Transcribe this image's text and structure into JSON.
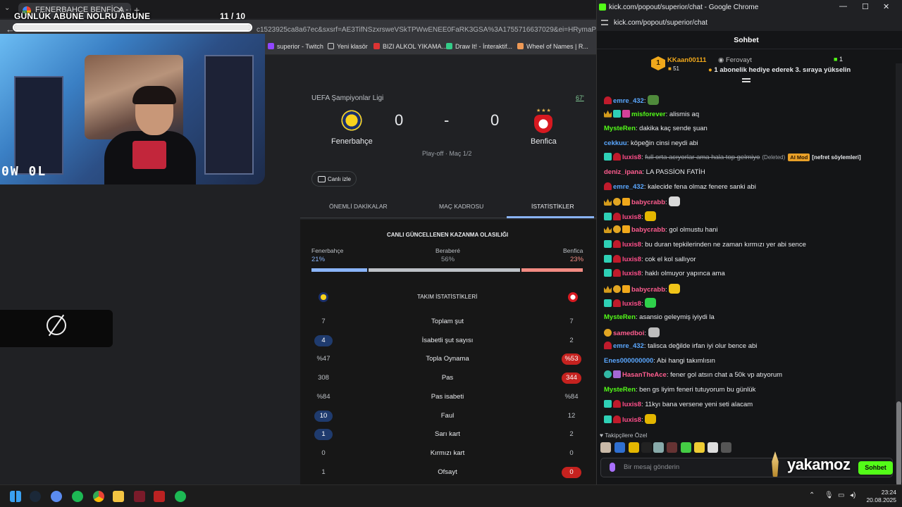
{
  "left_browser": {
    "tab_title": "FENERBAHÇE BENFİCA - Goog",
    "url_fragment": "c1523925ca8a67ec&sxsrf=AE3TifNSzxrsweVSkTPWwENEE0FaRK3GSA%3A1755716637029&ei=HRymaPi8AYrIwPAPiv",
    "bookmarks": [
      "superior - Twitch",
      "Yeni klasör",
      "BIZI ALKOL YIKAMA...",
      "Draw It! - İnteraktif...",
      "Wheel of Names | R..."
    ]
  },
  "overlay": {
    "title": "GÜNLÜK ABUNE NOLRU ABUNE",
    "count": "11  / 10",
    "progress": 1.0,
    "webcam_logo": "0W 0L"
  },
  "match": {
    "competition": "UEFA Şampiyonlar Ligi",
    "minute": "67'",
    "home_team": "Fenerbahçe",
    "away_team": "Benfica",
    "home_score": "0",
    "away_score": "0",
    "separator": "-",
    "round": "Play-off · Maç 1/2",
    "watch_label": "Canlı izle",
    "tabs": [
      "ÖNEMLİ DAKİKALAR",
      "MAÇ KADROSU",
      "İSTATİSTİKLER"
    ],
    "active_tab": "İSTATİSTİKLER",
    "prob_title": "CANLI GÜNCELLENEN KAZANMA OLASILIĞI",
    "prob": {
      "home_label": "Fenerbahçe",
      "draw_label": "Beraberé",
      "away_label": "Benfica",
      "home": "21%",
      "draw": "56%",
      "away": "23%",
      "home_val": 21,
      "draw_val": 56,
      "away_val": 23,
      "home_color": "#8ab4f8",
      "draw_color": "#bdc1c6",
      "away_color": "#f28b82"
    },
    "stats_title": "TAKIM İSTATİSTİKLERİ",
    "stats": [
      {
        "label": "Toplam şut",
        "home": "7",
        "away": "7",
        "hl": ""
      },
      {
        "label": "İsabetli şut sayısı",
        "home": "4",
        "away": "2",
        "hl": "home"
      },
      {
        "label": "Topla Oynama",
        "home": "%47",
        "away": "%53",
        "hl": "away"
      },
      {
        "label": "Pas",
        "home": "308",
        "away": "344",
        "hl": "away"
      },
      {
        "label": "Pas isabeti",
        "home": "%84",
        "away": "%84",
        "hl": ""
      },
      {
        "label": "Faul",
        "home": "10",
        "away": "12",
        "hl": "home"
      },
      {
        "label": "Sarı kart",
        "home": "1",
        "away": "2",
        "hl": "home"
      },
      {
        "label": "Kırmızı kart",
        "home": "0",
        "away": "0",
        "hl": ""
      },
      {
        "label": "Ofsayt",
        "home": "1",
        "away": "0",
        "hl": "away"
      }
    ]
  },
  "chat_window": {
    "title": "kick.com/popout/superior/chat - Google Chrome",
    "url": "kick.com/popout/superior/chat",
    "header": "Sohbet",
    "pinned": {
      "rank": "1",
      "user": "KKaan00111",
      "count": "51",
      "gifter": "Ferovayt",
      "gift_count": "1",
      "message": "1 abonelik hediye ederek 3. sıraya yükselin"
    },
    "messages": [
      {
        "user": "emre_432",
        "color": "#5aa7ff",
        "badges": [
          "red"
        ],
        "text": "",
        "emote": "#4f8a3b"
      },
      {
        "user": "misforever",
        "color": "#53fc18",
        "badges": [
          "crown",
          "sub",
          "gift"
        ],
        "text": "alismis aq"
      },
      {
        "user": "MysteRen",
        "color": "#53fc18",
        "badges": [],
        "text": "dakika kaç sende şuan"
      },
      {
        "user": "cekkuu",
        "color": "#5aa7ff",
        "badges": [],
        "text": "köpeğin cinsi neydi abi"
      },
      {
        "user": "luxis8",
        "color": "#ff4f8b",
        "badges": [
          "sub",
          "red"
        ],
        "text": "full orta acıyorlar ama hala top gelmiyo",
        "deleted": "(Deleted)",
        "mod": "AI Mod",
        "reason": "[nefret söylemleri]"
      },
      {
        "user": "deniz_ipana",
        "color": "#ff5d8f",
        "badges": [],
        "text": "LA PASSİON FATİH"
      },
      {
        "user": "emre_432",
        "color": "#5aa7ff",
        "badges": [
          "red"
        ],
        "text": "kalecide fena olmaz fenere sanki abi"
      },
      {
        "user": "babycrabb",
        "color": "#ff5d8f",
        "badges": [
          "crown",
          "og",
          "gold"
        ],
        "text": "",
        "emote": "#d9d9d9"
      },
      {
        "user": "luxis8",
        "color": "#ff4f8b",
        "badges": [
          "sub",
          "red"
        ],
        "text": "",
        "emote": "#e3b600"
      },
      {
        "user": "babycrabb",
        "color": "#ff5d8f",
        "badges": [
          "crown",
          "og",
          "gold"
        ],
        "text": "gol olmustu hani"
      },
      {
        "user": "luxis8",
        "color": "#ff4f8b",
        "badges": [
          "sub",
          "red"
        ],
        "text": "bu duran tepkilerinden ne zaman kırmızı yer abi sence"
      },
      {
        "user": "luxis8",
        "color": "#ff4f8b",
        "badges": [
          "sub",
          "red"
        ],
        "text": "cok el kol sallıyor"
      },
      {
        "user": "luxis8",
        "color": "#ff4f8b",
        "badges": [
          "sub",
          "red"
        ],
        "text": "haklı olmuyor yapınca ama"
      },
      {
        "user": "babycrabb",
        "color": "#ff5d8f",
        "badges": [
          "crown",
          "og",
          "gold"
        ],
        "text": "",
        "emote": "#f0c419"
      },
      {
        "user": "luxis8",
        "color": "#ff4f8b",
        "badges": [
          "sub",
          "red"
        ],
        "text": "",
        "emote": "#2fd14b"
      },
      {
        "user": "MysteRen",
        "color": "#53fc18",
        "badges": [],
        "text": "asansio geleymiş iyiydi la"
      },
      {
        "user": "samedboi",
        "color": "#ff5d8f",
        "badges": [
          "og"
        ],
        "text": "",
        "emote": "#bdbdbd"
      },
      {
        "user": "emre_432",
        "color": "#5aa7ff",
        "badges": [
          "red"
        ],
        "text": "talisca değilde irfan iyi olur bence abi"
      },
      {
        "user": "Enes000000000",
        "color": "#5aa7ff",
        "badges": [],
        "text": "Abi hangi takımlısın"
      },
      {
        "user": "HasanTheAce",
        "color": "#ff5d8f",
        "badges": [
          "teal",
          "purple"
        ],
        "text": "fener gol atsın chat a 50k vp atıyorum"
      },
      {
        "user": "MysteRen",
        "color": "#53fc18",
        "badges": [],
        "text": "ben gs liyim feneri tutuyorum bu günlük"
      },
      {
        "user": "luxis8",
        "color": "#ff4f8b",
        "badges": [
          "sub",
          "red"
        ],
        "text": "11kyı bana versene yeni seti alacam"
      },
      {
        "user": "luxis8",
        "color": "#ff4f8b",
        "badges": [
          "sub",
          "red"
        ],
        "text": "",
        "emote": "#e3b600"
      }
    ],
    "followers_label": "Takipçilere Özel",
    "input_placeholder": "Bir mesaj gönderin",
    "send_label": "Sohbet"
  },
  "watermark": "yakamoz",
  "taskbar": {
    "time": "23:24",
    "date": "20.08.2025"
  }
}
